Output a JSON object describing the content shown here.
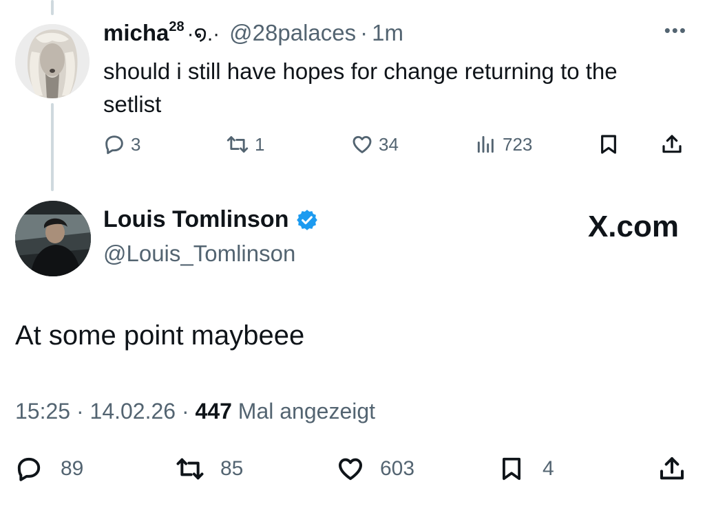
{
  "reply": {
    "name": "micha",
    "name_sup": "28",
    "name_deco": "·໑.·",
    "handle": "@28palaces",
    "separator": "·",
    "time": "1m",
    "more": "•••",
    "text": "should i still have hopes for change returning to the setlist",
    "stats": {
      "replies": "3",
      "reposts": "1",
      "likes": "34",
      "views": "723"
    }
  },
  "post": {
    "name": "Louis Tomlinson",
    "handle": "@Louis_Tomlinson",
    "brand": "X.com",
    "text": "At some point maybeee",
    "time": "15:25",
    "date": "14.02.26",
    "separator": "·",
    "views_count": "447",
    "views_label": "Mal angezeigt",
    "stats": {
      "replies": "89",
      "reposts": "85",
      "likes": "603",
      "bookmarks": "4"
    }
  },
  "colors": {
    "text": "#0f1419",
    "muted": "#536471",
    "verified": "#1d9bf0",
    "thread_line": "#cfd9de"
  }
}
